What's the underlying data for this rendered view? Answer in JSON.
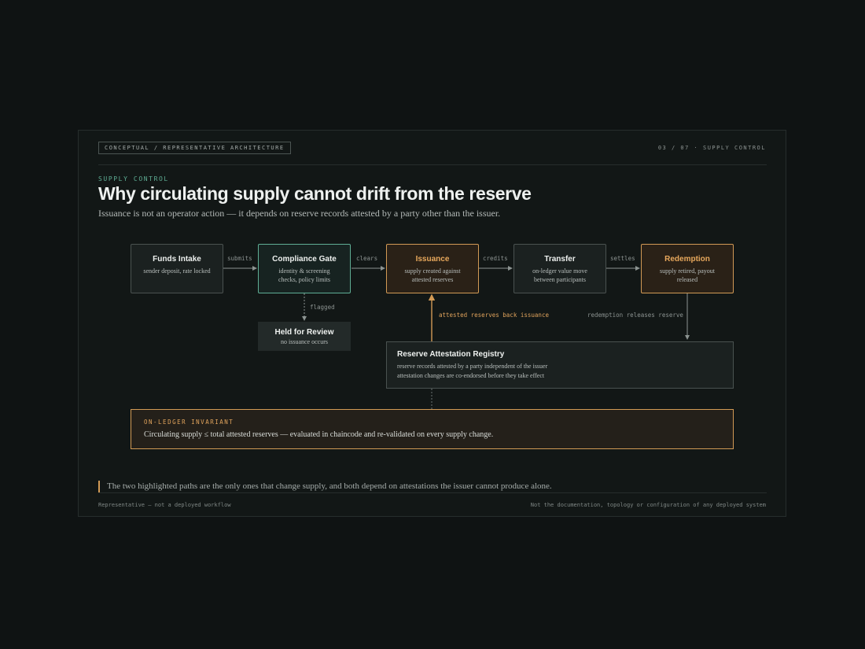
{
  "header": {
    "tag": "CONCEPTUAL / REPRESENTATIVE ARCHITECTURE",
    "pager": "03 / 07  ·  SUPPLY CONTROL"
  },
  "kicker": "SUPPLY CONTROL",
  "title": "Why circulating supply cannot drift from the reserve",
  "subtitle": "Issuance is not an operator action — it depends on reserve records attested by a party other than the issuer.",
  "nodes": {
    "funds_intake": {
      "title": "Funds Intake",
      "desc": "sender deposit, rate locked"
    },
    "compliance_gate": {
      "title": "Compliance Gate",
      "desc": "identity & screening checks, policy limits"
    },
    "issuance": {
      "title": "Issuance",
      "desc": "supply created against attested reserves"
    },
    "transfer": {
      "title": "Transfer",
      "desc": "on-ledger value move between participants"
    },
    "redemption": {
      "title": "Redemption",
      "desc": "supply retired, payout released"
    },
    "held": {
      "title": "Held for Review",
      "desc": "no issuance occurs"
    },
    "registry": {
      "title": "Reserve Attestation Registry",
      "line1": "reserve records attested by a party independent of the issuer",
      "line2": "attestation changes are co-endorsed before they take effect"
    }
  },
  "edges": {
    "submits": "submits",
    "clears": "clears",
    "credits": "credits",
    "settles": "settles",
    "flagged": "flagged",
    "attested": "attested reserves back issuance",
    "releases": "redemption releases reserve"
  },
  "invariant": {
    "label": "ON-LEDGER INVARIANT",
    "text": "Circulating supply ≤ total attested reserves — evaluated in chaincode and re-validated on every supply change."
  },
  "note": "The two highlighted paths are the only ones that change supply, and both depend on attestations the issuer cannot produce alone.",
  "footer": {
    "left": "Representative — not a deployed workflow",
    "right": "Not the documentation, topology or configuration of any deployed system"
  },
  "colors": {
    "accent_green": "#5fae95",
    "accent_amber": "#d29a55",
    "background": "#0f1313"
  }
}
